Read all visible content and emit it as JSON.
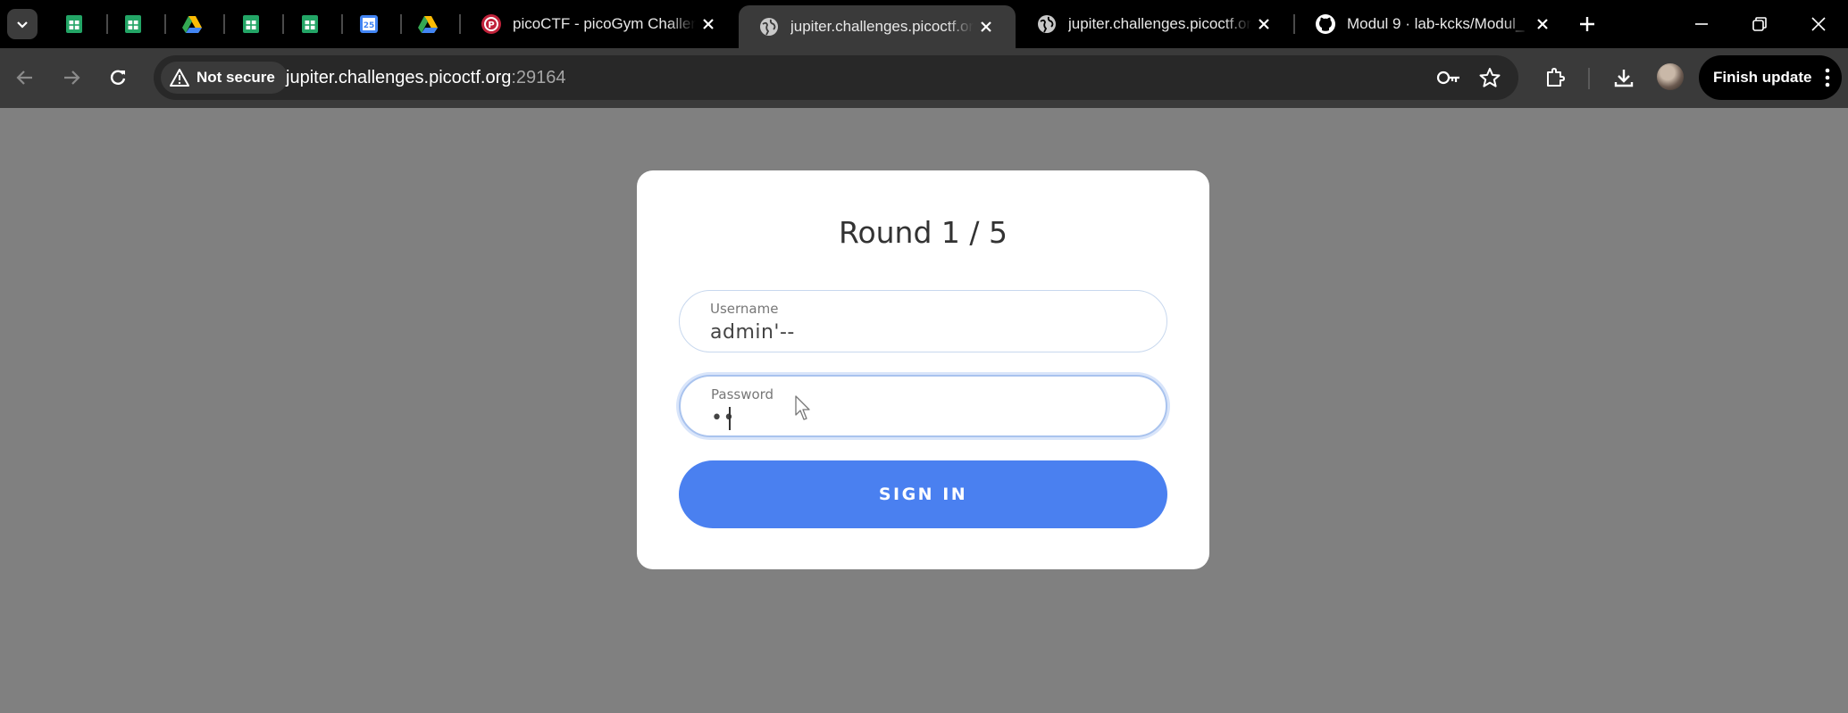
{
  "browser": {
    "tabs": [
      {
        "kind": "pinned",
        "icon": "google-sheets-icon"
      },
      {
        "kind": "pinned",
        "icon": "google-sheets-icon"
      },
      {
        "kind": "pinned",
        "icon": "google-drive-icon"
      },
      {
        "kind": "pinned",
        "icon": "google-sheets-icon"
      },
      {
        "kind": "pinned",
        "icon": "google-sheets-icon"
      },
      {
        "kind": "pinned",
        "icon": "google-calendar-icon",
        "badge": "25"
      },
      {
        "kind": "pinned",
        "icon": "google-drive-icon"
      },
      {
        "kind": "full",
        "icon": "picoctf-icon",
        "title": "picoCTF - picoGym Challen"
      },
      {
        "kind": "full",
        "icon": "globe-icon",
        "title": "jupiter.challenges.picoctf.or",
        "active": true
      },
      {
        "kind": "full",
        "icon": "globe-icon",
        "title": "jupiter.challenges.picoctf.or"
      },
      {
        "kind": "full",
        "icon": "github-icon",
        "title": "Modul 9 · lab-kcks/Modul_"
      }
    ],
    "security_label": "Not secure",
    "url_host": "jupiter.challenges.picoctf.org",
    "url_port": ":29164",
    "update_button": "Finish update"
  },
  "page": {
    "title": "Round 1 / 5",
    "username_label": "Username",
    "username_value": "admin'--",
    "password_label": "Password",
    "password_value": "••",
    "submit_label": "SIGN IN"
  },
  "colors": {
    "page_background": "#808080",
    "button_blue": "#4a80f0",
    "tab_strip": "#000000",
    "toolbar": "#3a3a3a"
  }
}
